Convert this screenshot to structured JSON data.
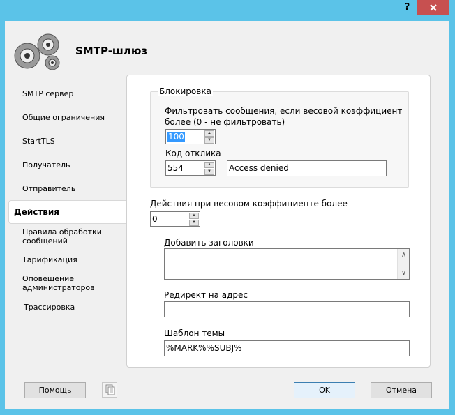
{
  "titlebar": {
    "help_label": "?",
    "close_label": "X"
  },
  "header": {
    "title": "SMTP-шлюз",
    "icon": "gears-icon"
  },
  "nav": {
    "items": [
      "SMTP сервер",
      "Общие ограничения",
      "StartTLS",
      "Получатель",
      "Отправитель",
      "Действия",
      "Правила обработки\nсообщений",
      "Тарификация",
      "Оповещение\nадминистраторов",
      "Трассировка"
    ],
    "active": "Действия"
  },
  "blocking": {
    "group_title": "Блокировка",
    "filter_label": "Фильтровать сообщения, если весовой коэффициент\nболее (0 - не фильтровать)",
    "filter_value": "100",
    "response_code_label": "Код отклика",
    "response_code_value": "554",
    "response_text_value": "Access denied"
  },
  "actions": {
    "weight_label": "Действия при весовом коэффициенте более",
    "weight_value": "0",
    "add_headers_label": "Добавить заголовки",
    "add_headers_value": "",
    "redirect_label": "Редирект на адрес",
    "redirect_value": "",
    "subject_template_label": "Шаблон темы",
    "subject_template_value": "%MARK%%SUBJ%"
  },
  "footer": {
    "help_button": "Помощь",
    "copy_icon": "copy-icon",
    "ok_button": "OK",
    "cancel_button": "Отмена"
  }
}
